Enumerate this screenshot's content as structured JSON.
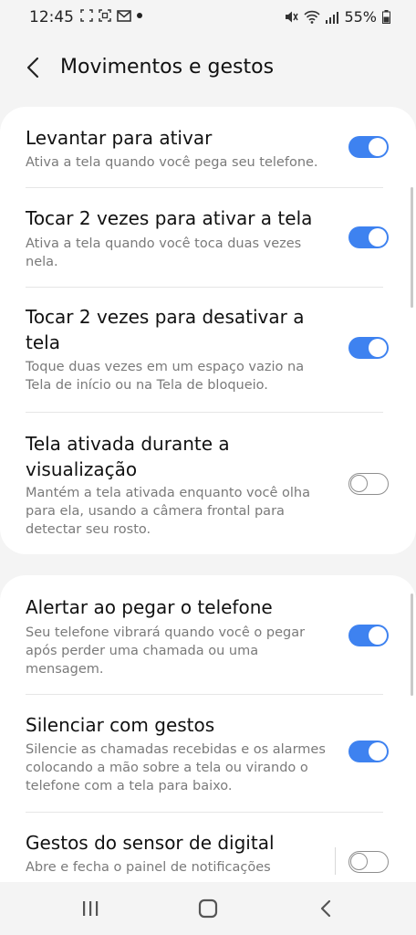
{
  "status_bar": {
    "time": "12:45",
    "battery": "55%"
  },
  "header": {
    "title": "Movimentos e gestos"
  },
  "settings": [
    {
      "title": "Levantar para ativar",
      "description": "Ativa a tela quando você pega seu telefone.",
      "enabled": true
    },
    {
      "title": "Tocar 2 vezes para ativar a tela",
      "description": "Ativa a tela quando você toca duas vezes nela.",
      "enabled": true
    },
    {
      "title": "Tocar 2 vezes para desativar a tela",
      "description": "Toque duas vezes em um espaço vazio na Tela de início ou na Tela de bloqueio.",
      "enabled": true
    },
    {
      "title": "Tela ativada durante a visualização",
      "description": "Mantém a tela ativada enquanto você olha para ela, usando a câmera frontal para detectar seu rosto.",
      "enabled": false
    },
    {
      "title": "Alertar ao pegar o telefone",
      "description": "Seu telefone vibrará quando você o pegar após perder uma chamada ou uma mensagem.",
      "enabled": true
    },
    {
      "title": "Silenciar com gestos",
      "description": "Silencie as chamadas recebidas e os alarmes colocando a mão sobre a tela ou virando o telefone com a tela para baixo.",
      "enabled": true
    },
    {
      "title": "Gestos do sensor de digital",
      "description": "Abre e fecha o painel de notificações",
      "enabled": false
    }
  ],
  "colors": {
    "accent": "#3e82f0",
    "background": "#f4f4f4",
    "card": "#ffffff"
  },
  "icons": {
    "back": "chevron-left-icon",
    "recents": "recents-icon",
    "home": "home-icon",
    "nav_back": "nav-back-icon"
  }
}
